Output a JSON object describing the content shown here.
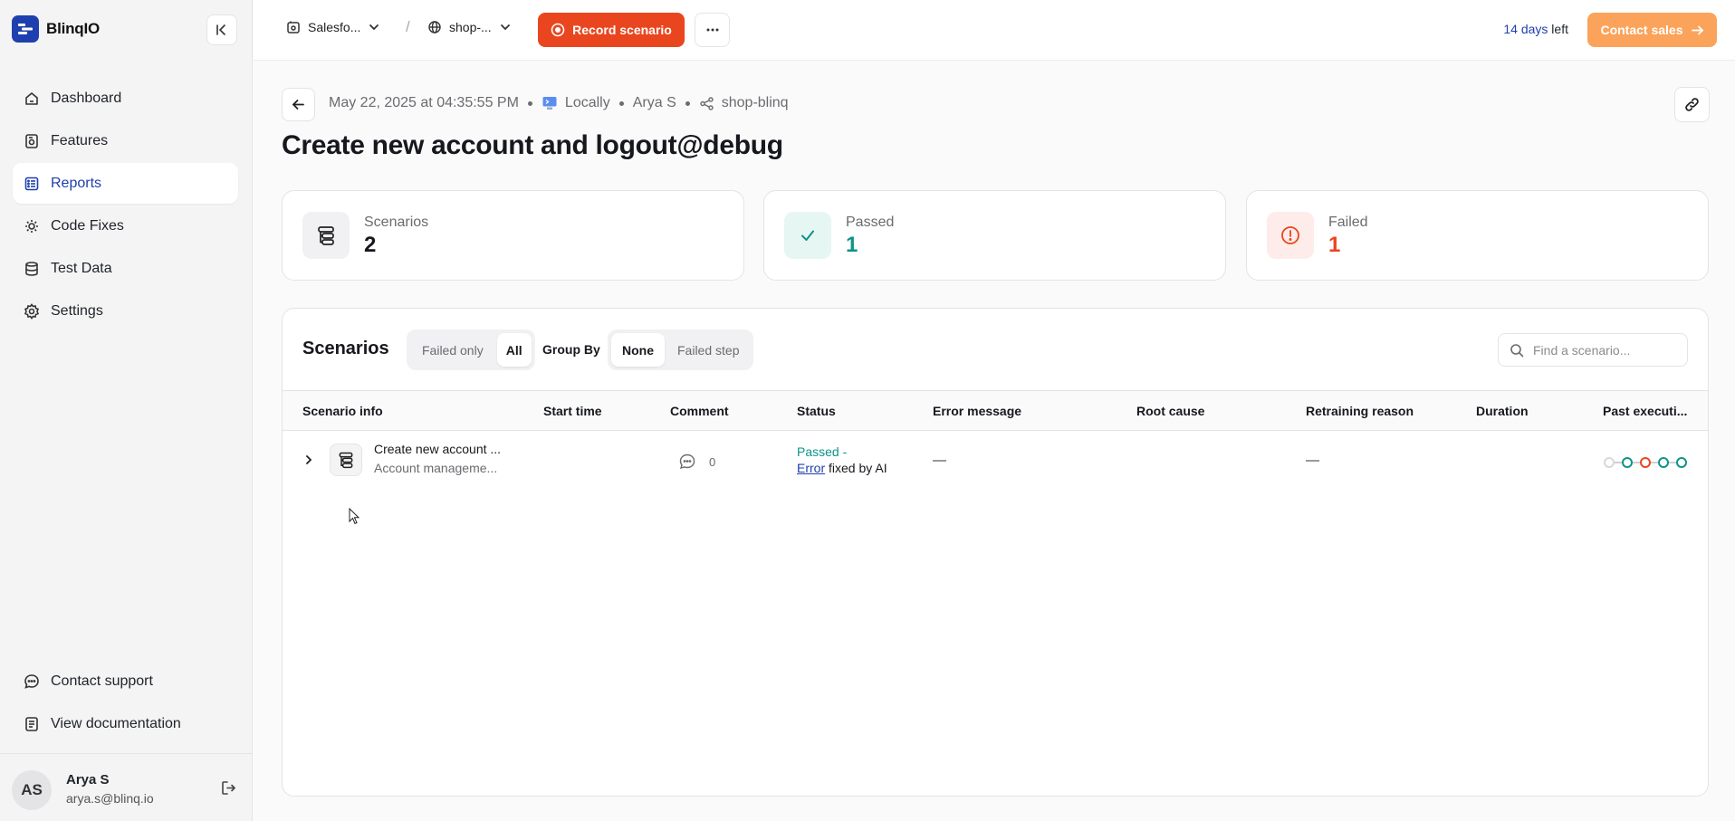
{
  "app": {
    "name": "BlinqIO"
  },
  "sidebar": {
    "items": [
      {
        "label": "Dashboard",
        "icon": "home-icon"
      },
      {
        "label": "Features",
        "icon": "feature-icon"
      },
      {
        "label": "Reports",
        "icon": "reports-icon"
      },
      {
        "label": "Code Fixes",
        "icon": "code-fixes-icon"
      },
      {
        "label": "Test Data",
        "icon": "database-icon"
      },
      {
        "label": "Settings",
        "icon": "gear-icon"
      }
    ],
    "active": "Reports",
    "bottom": [
      {
        "label": "Contact support"
      },
      {
        "label": "View documentation"
      }
    ],
    "user": {
      "initials": "AS",
      "name": "Arya S",
      "email": "arya.s@blinq.io"
    }
  },
  "topbar": {
    "project": "Salesfo...",
    "environment": "shop-...",
    "record_label": "Record scenario",
    "trial_days": "14 days",
    "trial_suffix": " left",
    "contact_label": "Contact sales"
  },
  "report": {
    "timestamp": "May 22, 2025 at 04:35:55 PM",
    "location": "Locally",
    "user": "Arya S",
    "project": "shop-blinq",
    "title": "Create new account and logout@debug"
  },
  "stats": {
    "scenarios": {
      "label": "Scenarios",
      "value": "2"
    },
    "passed": {
      "label": "Passed",
      "value": "1"
    },
    "failed": {
      "label": "Failed",
      "value": "1"
    }
  },
  "colors": {
    "accent": "#1e40af",
    "record": "#e9461f",
    "passed": "#0d9488",
    "failed": "#e9461f",
    "contact": "#fba35a"
  },
  "scenarios_panel": {
    "title": "Scenarios",
    "filter": {
      "options": [
        "Failed only",
        "All"
      ],
      "selected": "All"
    },
    "group_by": {
      "label": "Group By",
      "options": [
        "None",
        "Failed step"
      ],
      "selected": "None"
    },
    "search_placeholder": "Find a scenario...",
    "columns": [
      "Scenario info",
      "Start time",
      "Comment",
      "Status",
      "Error message",
      "Root cause",
      "Retraining reason",
      "Duration",
      "Past executi..."
    ],
    "rows": [
      {
        "name": "Create new account ...",
        "feature": "Account manageme...",
        "start_time": "",
        "comments": "0",
        "status_passed": "Passed -",
        "status_error_link": "Error",
        "status_suffix": " fixed by AI",
        "error_message": "—",
        "root_cause": "",
        "retraining_reason": "—",
        "duration": "",
        "past_executions": [
          "none",
          "passed",
          "failed",
          "passed",
          "passed"
        ]
      }
    ]
  }
}
